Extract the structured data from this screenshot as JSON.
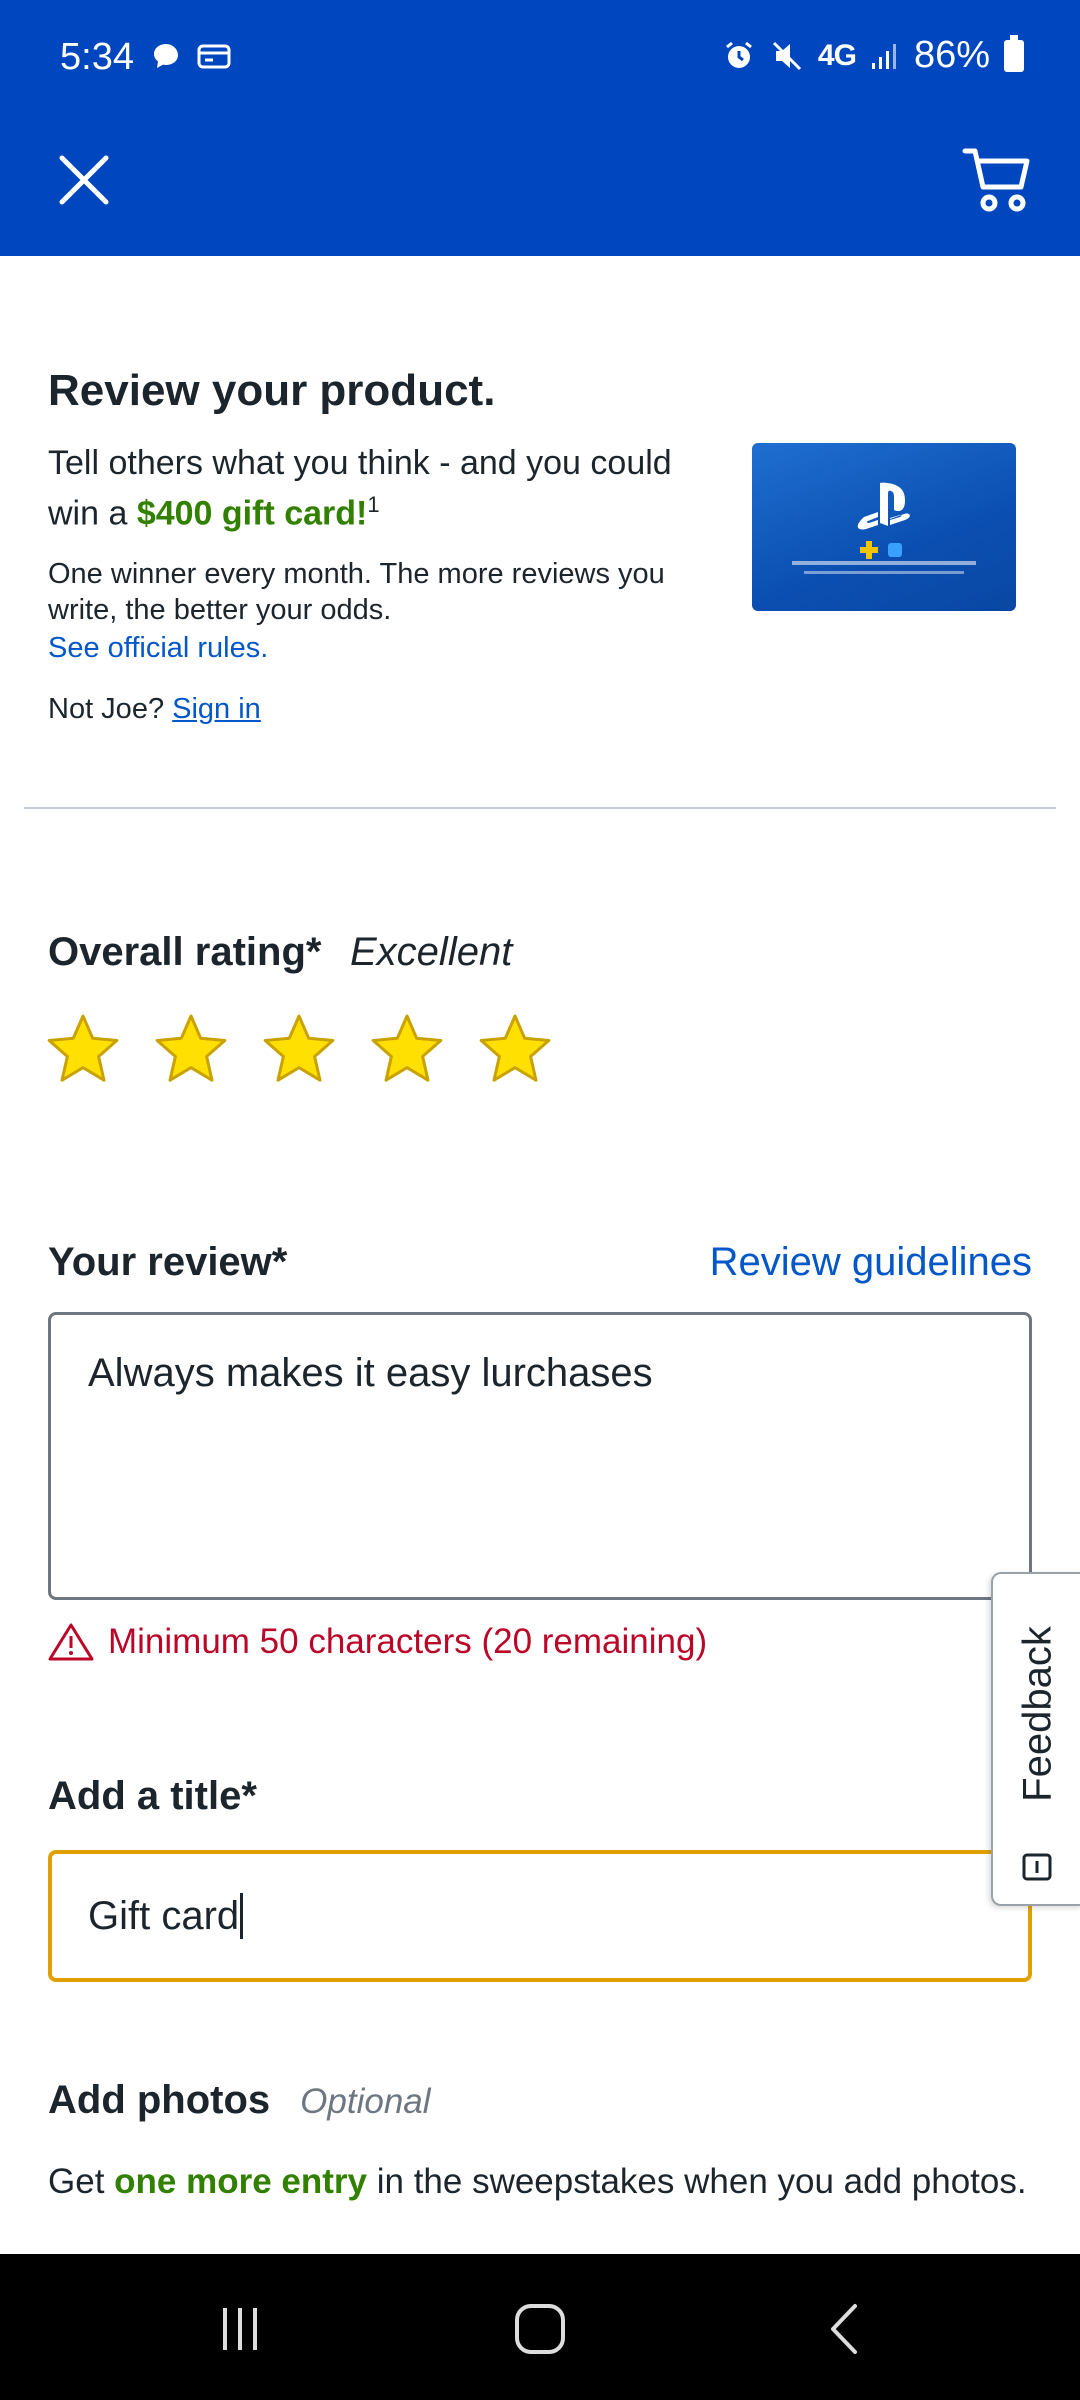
{
  "status_bar": {
    "time": "5:34",
    "network": "4G",
    "battery": "86%"
  },
  "header": {
    "close_icon": "close-icon",
    "cart_icon": "cart-icon",
    "background_color": "#0046be"
  },
  "promo": {
    "title": "Review your product.",
    "lead_prefix": "Tell others what you think - and you could win a ",
    "lead_highlight": "$400 gift card!",
    "lead_footnote": "1",
    "sub_text": "One winner every month. The more reviews you write, the better your odds.",
    "rules_link": "See official rules.",
    "not_user": "Not Joe?",
    "sign_in_link": "Sign in",
    "product_image": "playstation-gift-card"
  },
  "rating": {
    "label": "Overall rating*",
    "value_text": "Excellent",
    "stars_filled": 5,
    "stars_total": 5,
    "star_color": "#ffe000"
  },
  "review": {
    "label": "Your review*",
    "guidelines_link": "Review guidelines",
    "value": "Always makes it easy lurchases",
    "error": "Minimum 50 characters (20 remaining)",
    "error_color": "#bb0628"
  },
  "title_field": {
    "label": "Add a title*",
    "value": "Gift card",
    "focus_color": "#e0a100"
  },
  "photos": {
    "label": "Add photos",
    "optional": "Optional",
    "desc_prefix": "Get ",
    "desc_highlight": "one more entry",
    "desc_suffix": " in the sweepstakes when you add photos."
  },
  "feedback_tab": {
    "label": "Feedback"
  },
  "nav_bar": {
    "recents_icon": "recents-icon",
    "home_icon": "home-icon",
    "back_icon": "back-icon"
  },
  "colors": {
    "link": "#0457c8",
    "promo_green": "#318000"
  }
}
